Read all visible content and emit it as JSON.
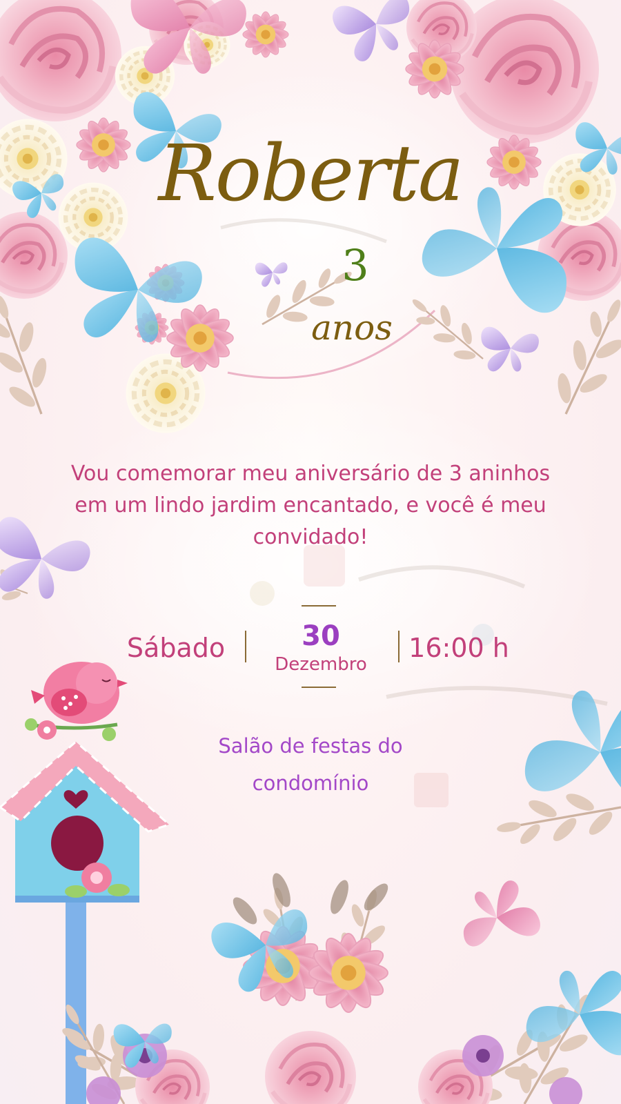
{
  "invitation": {
    "name": "Roberta",
    "age_number": "3",
    "age_word": "anos",
    "message_lines": [
      "Vou comemorar meu aniversário de 3 aninhos",
      "em um lindo jardim encantado, e você é meu",
      "convidado!"
    ],
    "weekday": "Sábado",
    "day": "30",
    "month": "Dezembro",
    "time": "16:00 h",
    "venue_lines": [
      "Salão de festas do",
      "condomínio"
    ]
  },
  "colors": {
    "name_gold": "#7c5d10",
    "age_green": "#4f7f1a",
    "text_pink": "#c2407a",
    "accent_purple": "#9b3fc0",
    "venue_purple": "#a348c8",
    "rose_pink": "#f2b8c6",
    "butterfly_blue": "#7cc8ea",
    "butterfly_lilac": "#c9a8ec",
    "leaf_beige": "#d9c0ad"
  },
  "decorations": {
    "top_frame": [
      "pink-rose",
      "white-dahlia",
      "pink-daisy",
      "blue-butterfly",
      "lilac-butterfly",
      "pink-butterfly"
    ],
    "birdhouse": [
      "pink-bird",
      "blue-birdhouse",
      "heart"
    ],
    "bottom_garden": [
      "pink-dahlia",
      "blue-butterfly",
      "pink-butterfly",
      "purple-flower",
      "beige-leaves"
    ]
  }
}
